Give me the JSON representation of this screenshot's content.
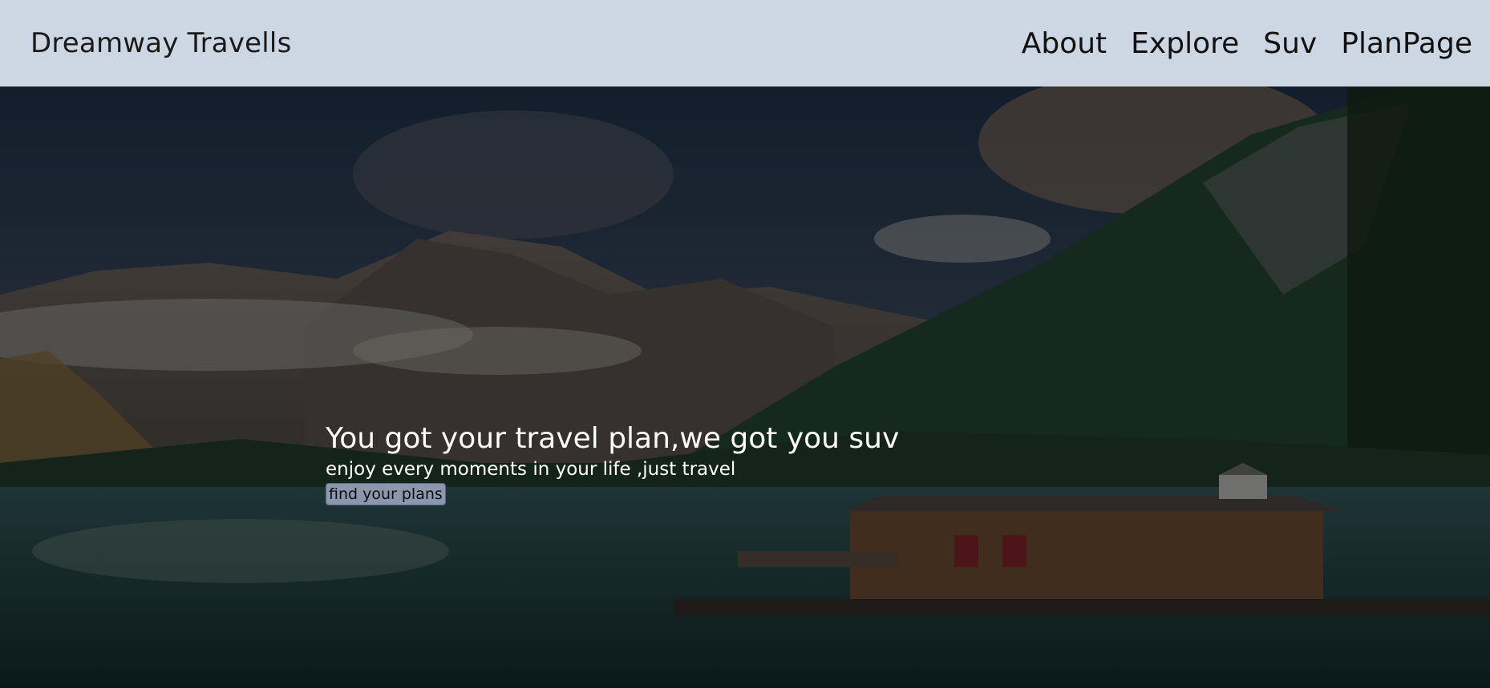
{
  "navbar": {
    "brand": "Dreamway Travells",
    "links": [
      {
        "label": "About"
      },
      {
        "label": "Explore"
      },
      {
        "label": "Suv"
      },
      {
        "label": "PlanPage"
      }
    ],
    "background": "#cdd7e3"
  },
  "hero": {
    "title": "You got your travel plan,we got you suv",
    "subtitle": "enjoy every moments in your life ,just travel",
    "button_label": "find your plans",
    "background_image": "mountain-lake-landscape"
  }
}
